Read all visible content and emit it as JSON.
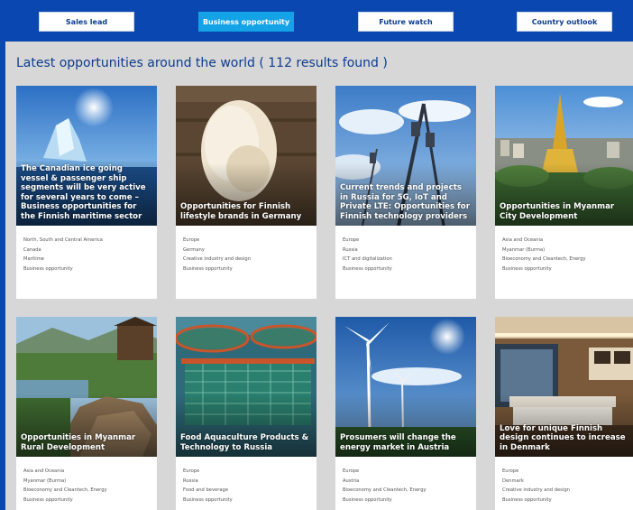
{
  "nav": {
    "items": [
      {
        "label": "Sales lead",
        "active": false
      },
      {
        "label": "Business opportunity",
        "active": true
      },
      {
        "label": "Future watch",
        "active": false
      },
      {
        "label": "Country outlook",
        "active": false
      }
    ]
  },
  "heading": "Latest opportunities around the world ( 112 results found )",
  "colors": {
    "brand_blue": "#0a47b0",
    "active_tab": "#13a3e6",
    "title_blue": "#0d3b8f",
    "background": "#d7d7d7"
  },
  "cards": [
    {
      "title": "The Canadian ice going vessel & passenger ship segments will be very active for several years to come – Business opportunities for the Finnish maritime sector",
      "meta": [
        "North, South and Central America",
        "Canada",
        "Maritime",
        "Business opportunity"
      ],
      "image": "icebreaker-ship-photo"
    },
    {
      "title": "Opportunities for Finnish lifestyle brands in Germany",
      "meta": [
        "Europe",
        "Germany",
        "Creative industry and design",
        "Business opportunity"
      ],
      "image": "sheepskin-photo"
    },
    {
      "title": "Current trends and projects in Russia for 5G, IoT and Private LTE: Opportunities for Finnish technology providers",
      "meta": [
        "Europe",
        "Russia",
        "ICT and digitalization",
        "Business opportunity"
      ],
      "image": "cell-tower-photo"
    },
    {
      "title": "Opportunities in Myanmar City Development",
      "meta": [
        "Asia and Oceania",
        "Myanmar (Burma)",
        "Bioeconomy and Cleantech, Energy",
        "Business opportunity"
      ],
      "image": "pagoda-city-photo"
    },
    {
      "title": "Opportunities in Myanmar Rural Development",
      "meta": [
        "Asia and Oceania",
        "Myanmar (Burma)",
        "Bioeconomy and Cleantech, Energy",
        "Business opportunity"
      ],
      "image": "rural-village-photo"
    },
    {
      "title": "Food Aquaculture Products & Technology to Russia",
      "meta": [
        "Europe",
        "Russia",
        "Food and beverage",
        "Business opportunity"
      ],
      "image": "fish-farm-nets-photo"
    },
    {
      "title": "Prosumers will change the energy market in Austria",
      "meta": [
        "Europe",
        "Austria",
        "Bioeconomy and Cleantech, Energy",
        "Business opportunity"
      ],
      "image": "wind-turbines-photo"
    },
    {
      "title": "Love for unique Finnish design continues to increase in Denmark",
      "meta": [
        "Europe",
        "Denmark",
        "Creative industry and design",
        "Business opportunity"
      ],
      "image": "living-room-photo"
    }
  ]
}
